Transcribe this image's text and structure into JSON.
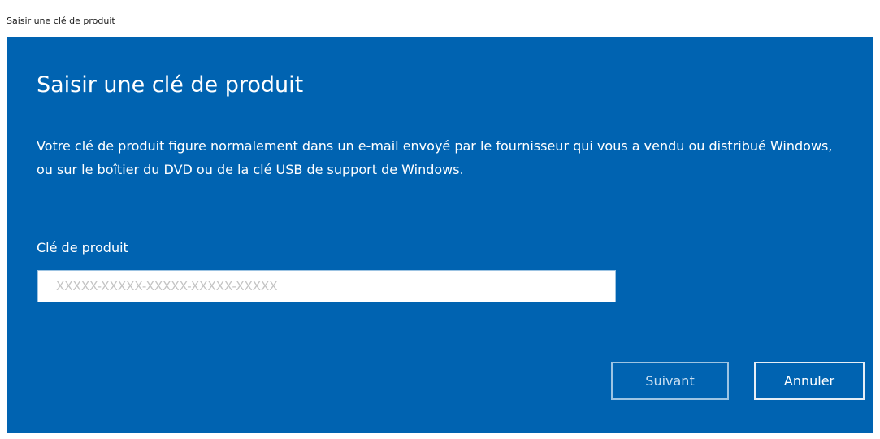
{
  "window": {
    "title": "Saisir une clé de produit"
  },
  "dialog": {
    "heading": "Saisir une clé de produit",
    "description": "Votre clé de produit figure normalement dans un e-mail envoyé par le fournisseur qui vous a vendu ou distribué Windows, ou sur le boîtier du DVD ou de la clé USB de support de Windows.",
    "field_label": "Clé de produit",
    "input": {
      "value": "",
      "placeholder": "XXXXX-XXXXX-XXXXX-XXXXX-XXXXX"
    },
    "buttons": {
      "next_label": "Suivant",
      "cancel_label": "Annuler"
    }
  },
  "colors": {
    "panel_background": "#0063b1",
    "text": "#ffffff",
    "input_background": "#ffffff",
    "placeholder_text": "#c4c4c4"
  }
}
